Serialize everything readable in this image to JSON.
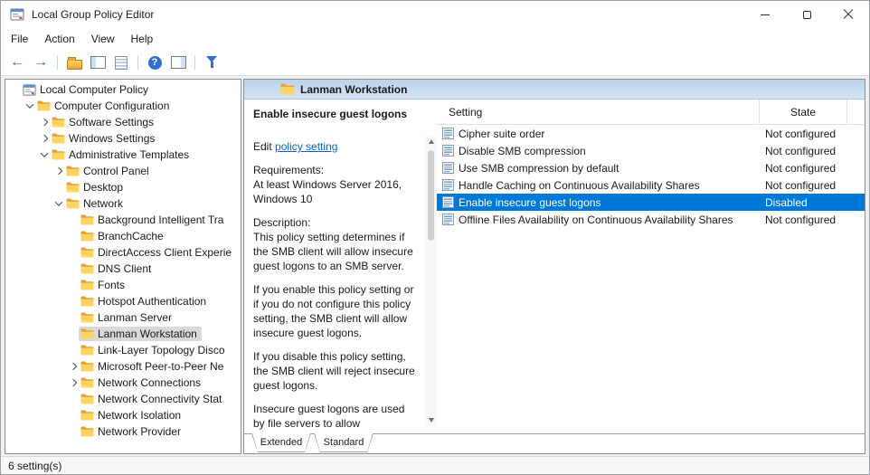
{
  "window": {
    "title": "Local Group Policy Editor",
    "status": "6 setting(s)"
  },
  "menubar": {
    "items": [
      {
        "label": "File",
        "name": "menu-file"
      },
      {
        "label": "Action",
        "name": "menu-action"
      },
      {
        "label": "View",
        "name": "menu-view"
      },
      {
        "label": "Help",
        "name": "menu-help"
      }
    ]
  },
  "toolbar": {
    "icons": [
      {
        "name": "back-icon"
      },
      {
        "name": "forward-icon"
      },
      {
        "name": "toolbar-separator",
        "interactable": false
      },
      {
        "name": "up-level-icon"
      },
      {
        "name": "show-console-tree-icon"
      },
      {
        "name": "export-list-icon"
      },
      {
        "name": "toolbar-separator",
        "interactable": false
      },
      {
        "name": "help-icon"
      },
      {
        "name": "action-pane-icon"
      },
      {
        "name": "toolbar-separator",
        "interactable": false
      },
      {
        "name": "filter-icon"
      }
    ]
  },
  "tree": {
    "items": [
      {
        "label": "Local Computer Policy",
        "level": 0,
        "icon": "console",
        "chevron": "none"
      },
      {
        "label": "Computer Configuration",
        "level": 1,
        "icon": "folder",
        "chevron": "down"
      },
      {
        "label": "Software Settings",
        "level": 2,
        "icon": "folder",
        "chevron": "right"
      },
      {
        "label": "Windows Settings",
        "level": 2,
        "icon": "folder",
        "chevron": "right"
      },
      {
        "label": "Administrative Templates",
        "level": 2,
        "icon": "folder",
        "chevron": "down"
      },
      {
        "label": "Control Panel",
        "level": 3,
        "icon": "folder",
        "chevron": "right"
      },
      {
        "label": "Desktop",
        "level": 3,
        "icon": "folder",
        "chevron": "none"
      },
      {
        "label": "Network",
        "level": 3,
        "icon": "folder",
        "chevron": "down"
      },
      {
        "label": "Background Intelligent Tra",
        "level": 4,
        "icon": "folder",
        "chevron": "none"
      },
      {
        "label": "BranchCache",
        "level": 4,
        "icon": "folder",
        "chevron": "none"
      },
      {
        "label": "DirectAccess Client Experie",
        "level": 4,
        "icon": "folder",
        "chevron": "none"
      },
      {
        "label": "DNS Client",
        "level": 4,
        "icon": "folder",
        "chevron": "none"
      },
      {
        "label": "Fonts",
        "level": 4,
        "icon": "folder",
        "chevron": "none"
      },
      {
        "label": "Hotspot Authentication",
        "level": 4,
        "icon": "folder",
        "chevron": "none"
      },
      {
        "label": "Lanman Server",
        "level": 4,
        "icon": "folder",
        "chevron": "none"
      },
      {
        "label": "Lanman Workstation",
        "level": 4,
        "icon": "folder",
        "chevron": "none",
        "selected": true
      },
      {
        "label": "Link-Layer Topology Disco",
        "level": 4,
        "icon": "folder",
        "chevron": "none"
      },
      {
        "label": "Microsoft Peer-to-Peer Ne",
        "level": 4,
        "icon": "folder",
        "chevron": "right"
      },
      {
        "label": "Network Connections",
        "level": 4,
        "icon": "folder",
        "chevron": "right"
      },
      {
        "label": "Network Connectivity Stat",
        "level": 4,
        "icon": "folder",
        "chevron": "none"
      },
      {
        "label": "Network Isolation",
        "level": 4,
        "icon": "folder",
        "chevron": "none"
      },
      {
        "label": "Network Provider",
        "level": 4,
        "icon": "folder",
        "chevron": "none"
      }
    ]
  },
  "content": {
    "header": {
      "title": "Lanman Workstation"
    },
    "detail": {
      "title": "Enable insecure guest logons",
      "edit_prefix": "Edit ",
      "edit_link": "policy setting",
      "requirements_label": "Requirements:",
      "requirements_text": "At least Windows Server 2016, Windows 10",
      "description_label": "Description:",
      "paragraphs": [
        "This policy setting determines if the SMB client will allow insecure guest logons to an SMB server.",
        "If you enable this policy setting or if you do not configure this policy setting, the SMB client will allow insecure guest logons.",
        "If you disable this policy setting, the SMB client will reject insecure guest logons.",
        "Insecure guest logons are used by file servers to allow"
      ]
    },
    "list": {
      "columns": [
        "Setting",
        "State"
      ],
      "rows": [
        {
          "setting": "Cipher suite order",
          "state": "Not configured"
        },
        {
          "setting": "Disable SMB compression",
          "state": "Not configured"
        },
        {
          "setting": "Use SMB compression by default",
          "state": "Not configured"
        },
        {
          "setting": "Handle Caching on Continuous Availability Shares",
          "state": "Not configured"
        },
        {
          "setting": "Enable insecure guest logons",
          "state": "Disabled",
          "selected": true
        },
        {
          "setting": "Offline Files Availability on Continuous Availability Shares",
          "state": "Not configured"
        }
      ]
    },
    "tabs": [
      {
        "label": "Extended",
        "name": "tab-extended",
        "active": true
      },
      {
        "label": "Standard",
        "name": "tab-standard",
        "active": false
      }
    ]
  },
  "colors": {
    "selection": "#0078d7",
    "selection_text": "#ffffff",
    "tree_selection": "#d9d9d9",
    "link": "#0066cc",
    "header_band_top": "#bcd2ea",
    "header_band_bottom": "#d5e5f6",
    "folder_back": "#e8a33d",
    "folder_front": "#fcd462"
  }
}
